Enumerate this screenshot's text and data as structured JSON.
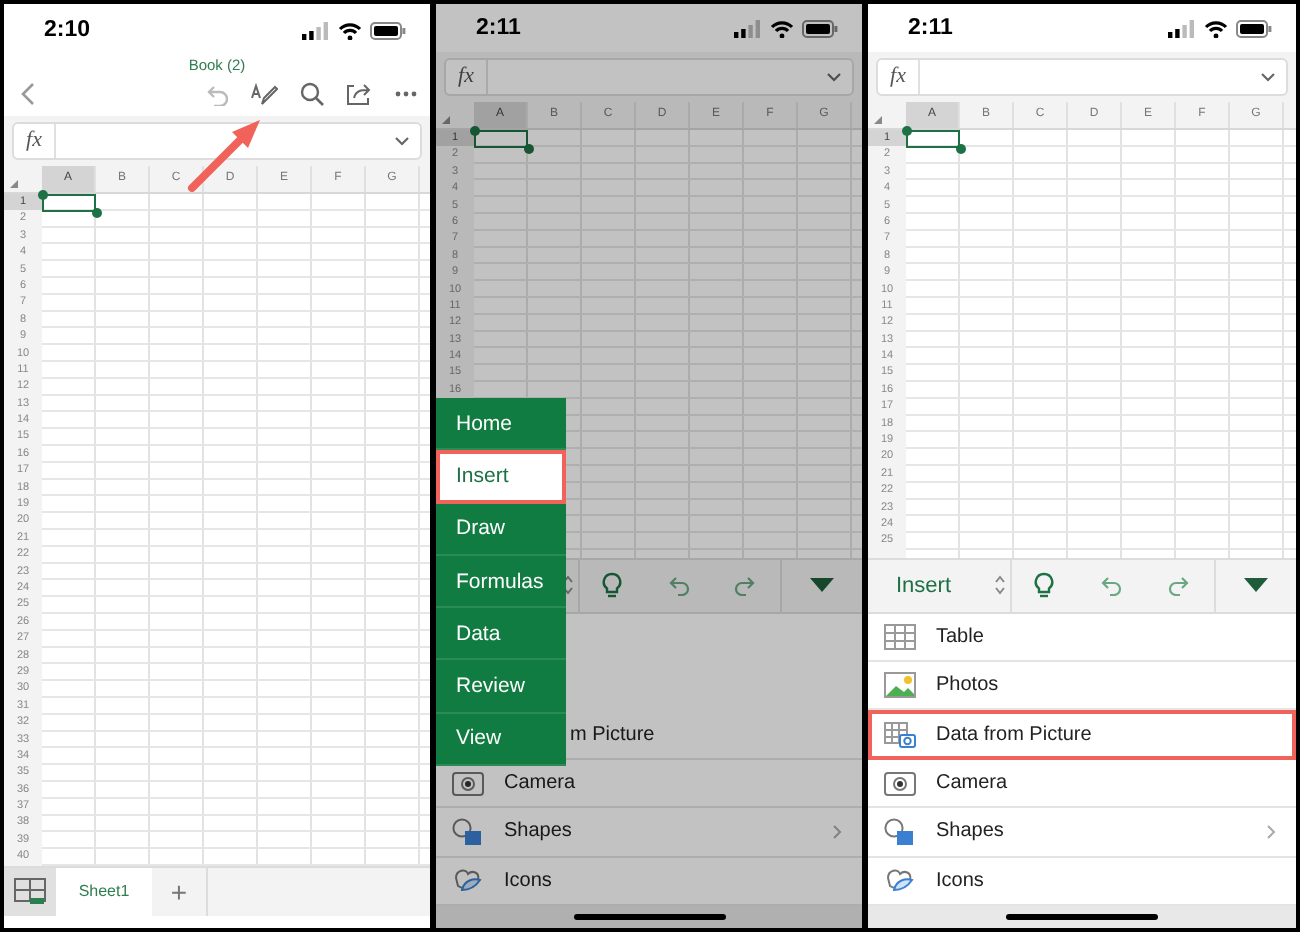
{
  "panels": [
    {
      "kind": "workbook",
      "dimmed": false,
      "status": {
        "time": "2:10"
      },
      "title": "Book (2)",
      "formula_label": "fx",
      "columns": [
        {
          "label": "A",
          "selected": true
        },
        {
          "label": "B",
          "selected": false
        },
        {
          "label": "C",
          "selected": false
        },
        {
          "label": "D",
          "selected": false
        },
        {
          "label": "E",
          "selected": false
        },
        {
          "label": "F",
          "selected": false
        },
        {
          "label": "G",
          "selected": false
        }
      ],
      "rows": [
        {
          "label": "1",
          "selected": true
        },
        {
          "label": "2",
          "selected": false
        },
        {
          "label": "3",
          "selected": false
        },
        {
          "label": "4",
          "selected": false
        },
        {
          "label": "5",
          "selected": false
        },
        {
          "label": "6",
          "selected": false
        },
        {
          "label": "7",
          "selected": false
        },
        {
          "label": "8",
          "selected": false
        },
        {
          "label": "9",
          "selected": false
        },
        {
          "label": "10",
          "selected": false
        },
        {
          "label": "11",
          "selected": false
        },
        {
          "label": "12",
          "selected": false
        },
        {
          "label": "13",
          "selected": false
        },
        {
          "label": "14",
          "selected": false
        },
        {
          "label": "15",
          "selected": false
        },
        {
          "label": "16",
          "selected": false
        },
        {
          "label": "17",
          "selected": false
        },
        {
          "label": "18",
          "selected": false
        },
        {
          "label": "19",
          "selected": false
        },
        {
          "label": "20",
          "selected": false
        },
        {
          "label": "21",
          "selected": false
        },
        {
          "label": "22",
          "selected": false
        },
        {
          "label": "23",
          "selected": false
        },
        {
          "label": "24",
          "selected": false
        },
        {
          "label": "25",
          "selected": false
        },
        {
          "label": "26",
          "selected": false
        },
        {
          "label": "27",
          "selected": false
        },
        {
          "label": "28",
          "selected": false
        },
        {
          "label": "29",
          "selected": false
        },
        {
          "label": "30",
          "selected": false
        },
        {
          "label": "31",
          "selected": false
        },
        {
          "label": "32",
          "selected": false
        },
        {
          "label": "33",
          "selected": false
        },
        {
          "label": "34",
          "selected": false
        },
        {
          "label": "35",
          "selected": false
        },
        {
          "label": "36",
          "selected": false
        },
        {
          "label": "37",
          "selected": false
        },
        {
          "label": "38",
          "selected": false
        },
        {
          "label": "39",
          "selected": false
        },
        {
          "label": "40",
          "selected": false
        }
      ],
      "sheet_tabs": [
        {
          "label": "Sheet1",
          "selected": true
        }
      ],
      "add_sheet": "+"
    },
    {
      "kind": "ribbon",
      "dimmed": true,
      "status": {
        "time": "2:11"
      },
      "formula_label": "fx",
      "columns": [
        {
          "label": "A",
          "selected": true
        },
        {
          "label": "B",
          "selected": false
        },
        {
          "label": "C",
          "selected": false
        },
        {
          "label": "D",
          "selected": false
        },
        {
          "label": "E",
          "selected": false
        },
        {
          "label": "F",
          "selected": false
        },
        {
          "label": "G",
          "selected": false
        }
      ],
      "rows": [
        {
          "label": "1",
          "selected": true
        },
        {
          "label": "2",
          "selected": false
        },
        {
          "label": "3",
          "selected": false
        },
        {
          "label": "4",
          "selected": false
        },
        {
          "label": "5",
          "selected": false
        },
        {
          "label": "6",
          "selected": false
        },
        {
          "label": "7",
          "selected": false
        },
        {
          "label": "8",
          "selected": false
        },
        {
          "label": "9",
          "selected": false
        },
        {
          "label": "10",
          "selected": false
        },
        {
          "label": "11",
          "selected": false
        },
        {
          "label": "12",
          "selected": false
        },
        {
          "label": "13",
          "selected": false
        },
        {
          "label": "14",
          "selected": false
        },
        {
          "label": "15",
          "selected": false
        },
        {
          "label": "16",
          "selected": false
        }
      ],
      "items": [
        {
          "kind": "covered",
          "label": "m Picture",
          "selected": false,
          "submenu": false
        },
        {
          "kind": "camera",
          "label": "Camera",
          "selected": false,
          "submenu": false
        },
        {
          "kind": "shapes",
          "label": "Shapes",
          "selected": false,
          "submenu": true
        },
        {
          "kind": "icons",
          "label": "Icons",
          "selected": false,
          "submenu": false
        }
      ],
      "tab_menu": [
        {
          "label": "Home",
          "selected": false
        },
        {
          "label": "Insert",
          "selected": true
        },
        {
          "label": "Draw",
          "selected": false
        },
        {
          "label": "Formulas",
          "selected": false
        },
        {
          "label": "Data",
          "selected": false
        },
        {
          "label": "Review",
          "selected": false
        },
        {
          "label": "View",
          "selected": false
        }
      ]
    },
    {
      "kind": "ribbon",
      "dimmed": false,
      "status": {
        "time": "2:11"
      },
      "formula_label": "fx",
      "columns": [
        {
          "label": "A",
          "selected": true
        },
        {
          "label": "B",
          "selected": false
        },
        {
          "label": "C",
          "selected": false
        },
        {
          "label": "D",
          "selected": false
        },
        {
          "label": "E",
          "selected": false
        },
        {
          "label": "F",
          "selected": false
        },
        {
          "label": "G",
          "selected": false
        }
      ],
      "rows": [
        {
          "label": "1",
          "selected": true
        },
        {
          "label": "2",
          "selected": false
        },
        {
          "label": "3",
          "selected": false
        },
        {
          "label": "4",
          "selected": false
        },
        {
          "label": "5",
          "selected": false
        },
        {
          "label": "6",
          "selected": false
        },
        {
          "label": "7",
          "selected": false
        },
        {
          "label": "8",
          "selected": false
        },
        {
          "label": "9",
          "selected": false
        },
        {
          "label": "10",
          "selected": false
        },
        {
          "label": "11",
          "selected": false
        },
        {
          "label": "12",
          "selected": false
        },
        {
          "label": "13",
          "selected": false
        },
        {
          "label": "14",
          "selected": false
        },
        {
          "label": "15",
          "selected": false
        },
        {
          "label": "16",
          "selected": false
        },
        {
          "label": "17",
          "selected": false
        },
        {
          "label": "18",
          "selected": false
        },
        {
          "label": "19",
          "selected": false
        },
        {
          "label": "20",
          "selected": false
        },
        {
          "label": "21",
          "selected": false
        },
        {
          "label": "22",
          "selected": false
        },
        {
          "label": "23",
          "selected": false
        },
        {
          "label": "24",
          "selected": false
        },
        {
          "label": "25",
          "selected": false
        }
      ],
      "toolbar": {
        "label": "Insert"
      },
      "items": [
        {
          "kind": "table",
          "label": "Table",
          "selected": false,
          "submenu": false
        },
        {
          "kind": "photos",
          "label": "Photos",
          "selected": false,
          "submenu": false
        },
        {
          "kind": "data-picture",
          "label": "Data from Picture",
          "selected": true,
          "submenu": false
        },
        {
          "kind": "camera",
          "label": "Camera",
          "selected": false,
          "submenu": false
        },
        {
          "kind": "shapes",
          "label": "Shapes",
          "selected": false,
          "submenu": true
        },
        {
          "kind": "icons",
          "label": "Icons",
          "selected": false,
          "submenu": false
        }
      ]
    }
  ]
}
